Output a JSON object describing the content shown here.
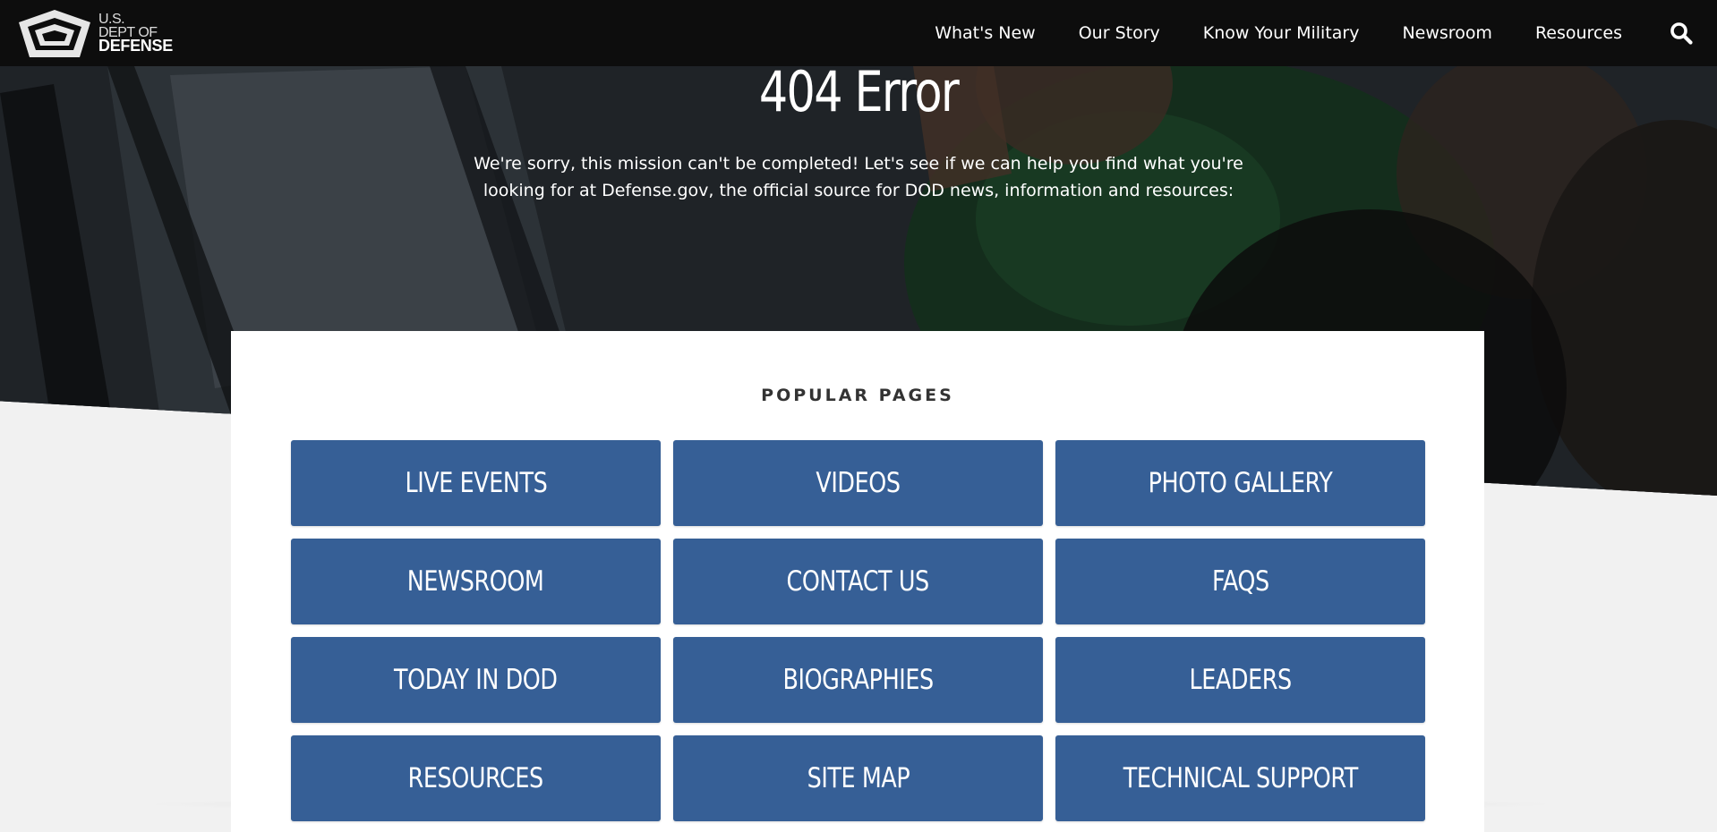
{
  "header": {
    "logo": {
      "line1": "U.S.",
      "line2": "DEPT OF",
      "line3": "DEFENSE"
    },
    "nav": [
      {
        "label": "What's New"
      },
      {
        "label": "Our Story"
      },
      {
        "label": "Know Your Military"
      },
      {
        "label": "Newsroom"
      },
      {
        "label": "Resources"
      }
    ],
    "search_icon": "search-icon"
  },
  "hero": {
    "title": "404 Error",
    "message": "We're sorry, this mission can't be completed! Let's see if we can help you find what you're looking for at Defense.gov, the official source for DOD news, information and resources:"
  },
  "popular": {
    "heading": "POPULAR PAGES",
    "links": [
      {
        "label": "LIVE EVENTS"
      },
      {
        "label": "VIDEOS"
      },
      {
        "label": "PHOTO GALLERY"
      },
      {
        "label": "NEWSROOM"
      },
      {
        "label": "CONTACT US"
      },
      {
        "label": "FAQS"
      },
      {
        "label": "TODAY IN DOD"
      },
      {
        "label": "BIOGRAPHIES"
      },
      {
        "label": "LEADERS"
      },
      {
        "label": "RESOURCES"
      },
      {
        "label": "SITE MAP"
      },
      {
        "label": "TECHNICAL SUPPORT"
      }
    ]
  },
  "colors": {
    "header_bg": "#0d0d0d",
    "tile_bg": "#365f96",
    "page_bg": "#f1f1f1"
  }
}
